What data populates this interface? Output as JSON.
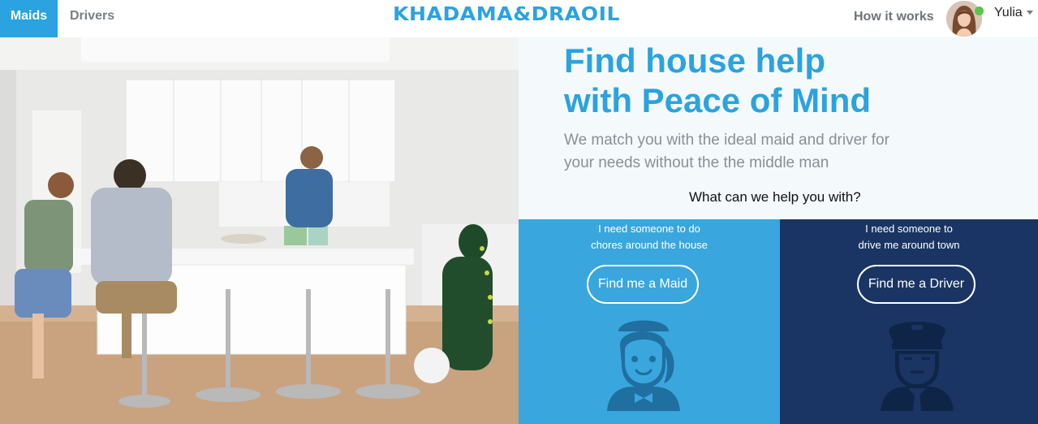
{
  "nav": {
    "tabs": [
      {
        "label": "Maids",
        "active": true
      },
      {
        "label": "Drivers",
        "active": false
      }
    ],
    "logo": "KHADAMA&DRAOIL",
    "how_it_works": "How it works",
    "user": {
      "name": "Yulia",
      "online": true
    }
  },
  "hero": {
    "headline_line1": "Find house help",
    "headline_line2": "with Peace of Mind",
    "subtitle_line1": "We match you with the ideal maid and driver for",
    "subtitle_line2": "your needs without the the middle man",
    "question": "What can we help you with?"
  },
  "options": [
    {
      "line1": "I need someone to do",
      "line2": "chores around the house",
      "button": "Find me a Maid",
      "icon": "maid-icon"
    },
    {
      "line1": "I need someone to",
      "line2": "drive me around town",
      "button": "Find me a Driver",
      "icon": "chauffeur-icon"
    }
  ],
  "colors": {
    "brand": "#2aa3e0",
    "maid_panel": "#3aa6de",
    "driver_panel": "#1a3564",
    "online": "#5dc24a"
  }
}
